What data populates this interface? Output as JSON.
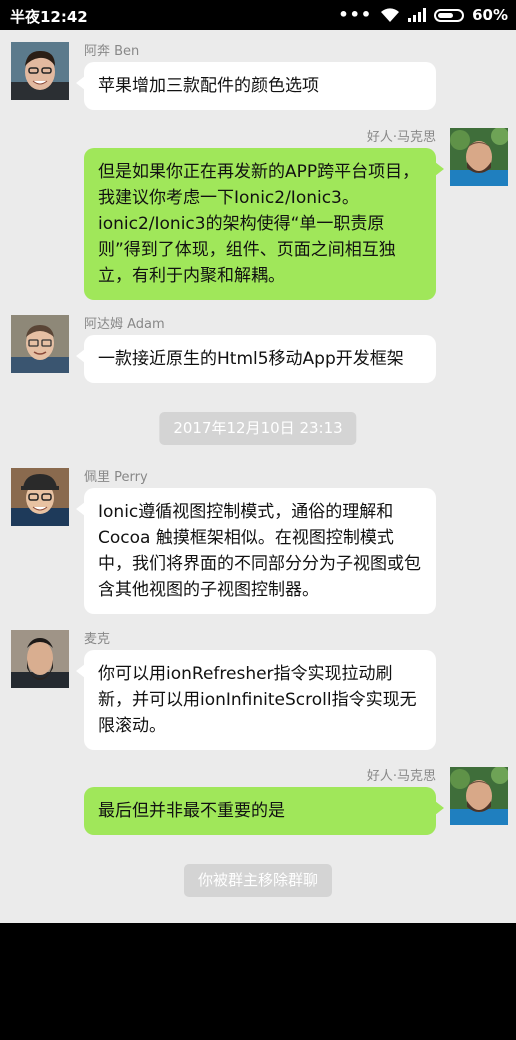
{
  "status_bar": {
    "time": "半夜12:42",
    "signal_dots": "•••",
    "battery": "60%"
  },
  "messages": [
    {
      "side": "left",
      "name": "阿奔 Ben",
      "text": "苹果增加三款配件的颜色选项"
    },
    {
      "side": "right",
      "name": "好人·马克思",
      "text": "但是如果你正在再发新的APP跨平台项目，我建议你考虑一下Ionic2/Ionic3。ionic2/Ionic3的架构使得“单一职责原则”得到了体现，组件、页面之间相互独立，有利于内聚和解耦。"
    },
    {
      "side": "left",
      "name": "阿达姆 Adam",
      "text": "一款接近原生的Html5移动App开发框架"
    },
    {
      "side": "system",
      "text": "2017年12月10日 23:13"
    },
    {
      "side": "left",
      "name": "佩里 Perry",
      "text": "Ionic遵循视图控制模式，通俗的理解和Cocoa 触摸框架相似。在视图控制模式中，我们将界面的不同部分分为子视图或包含其他视图的子视图控制器。"
    },
    {
      "side": "left",
      "name": "麦克",
      "text": "你可以用ionRefresher指令实现拉动刷新，并可以用ionInfiniteScroll指令实现无限滚动。"
    },
    {
      "side": "right",
      "name": "好人·马克思",
      "text": "最后但并非最不重要的是"
    },
    {
      "side": "system",
      "text": "你被群主移除群聊"
    }
  ],
  "colors": {
    "chat_background": "#ebebeb",
    "own_bubble": "#a0e75a",
    "other_bubble": "#ffffff"
  }
}
